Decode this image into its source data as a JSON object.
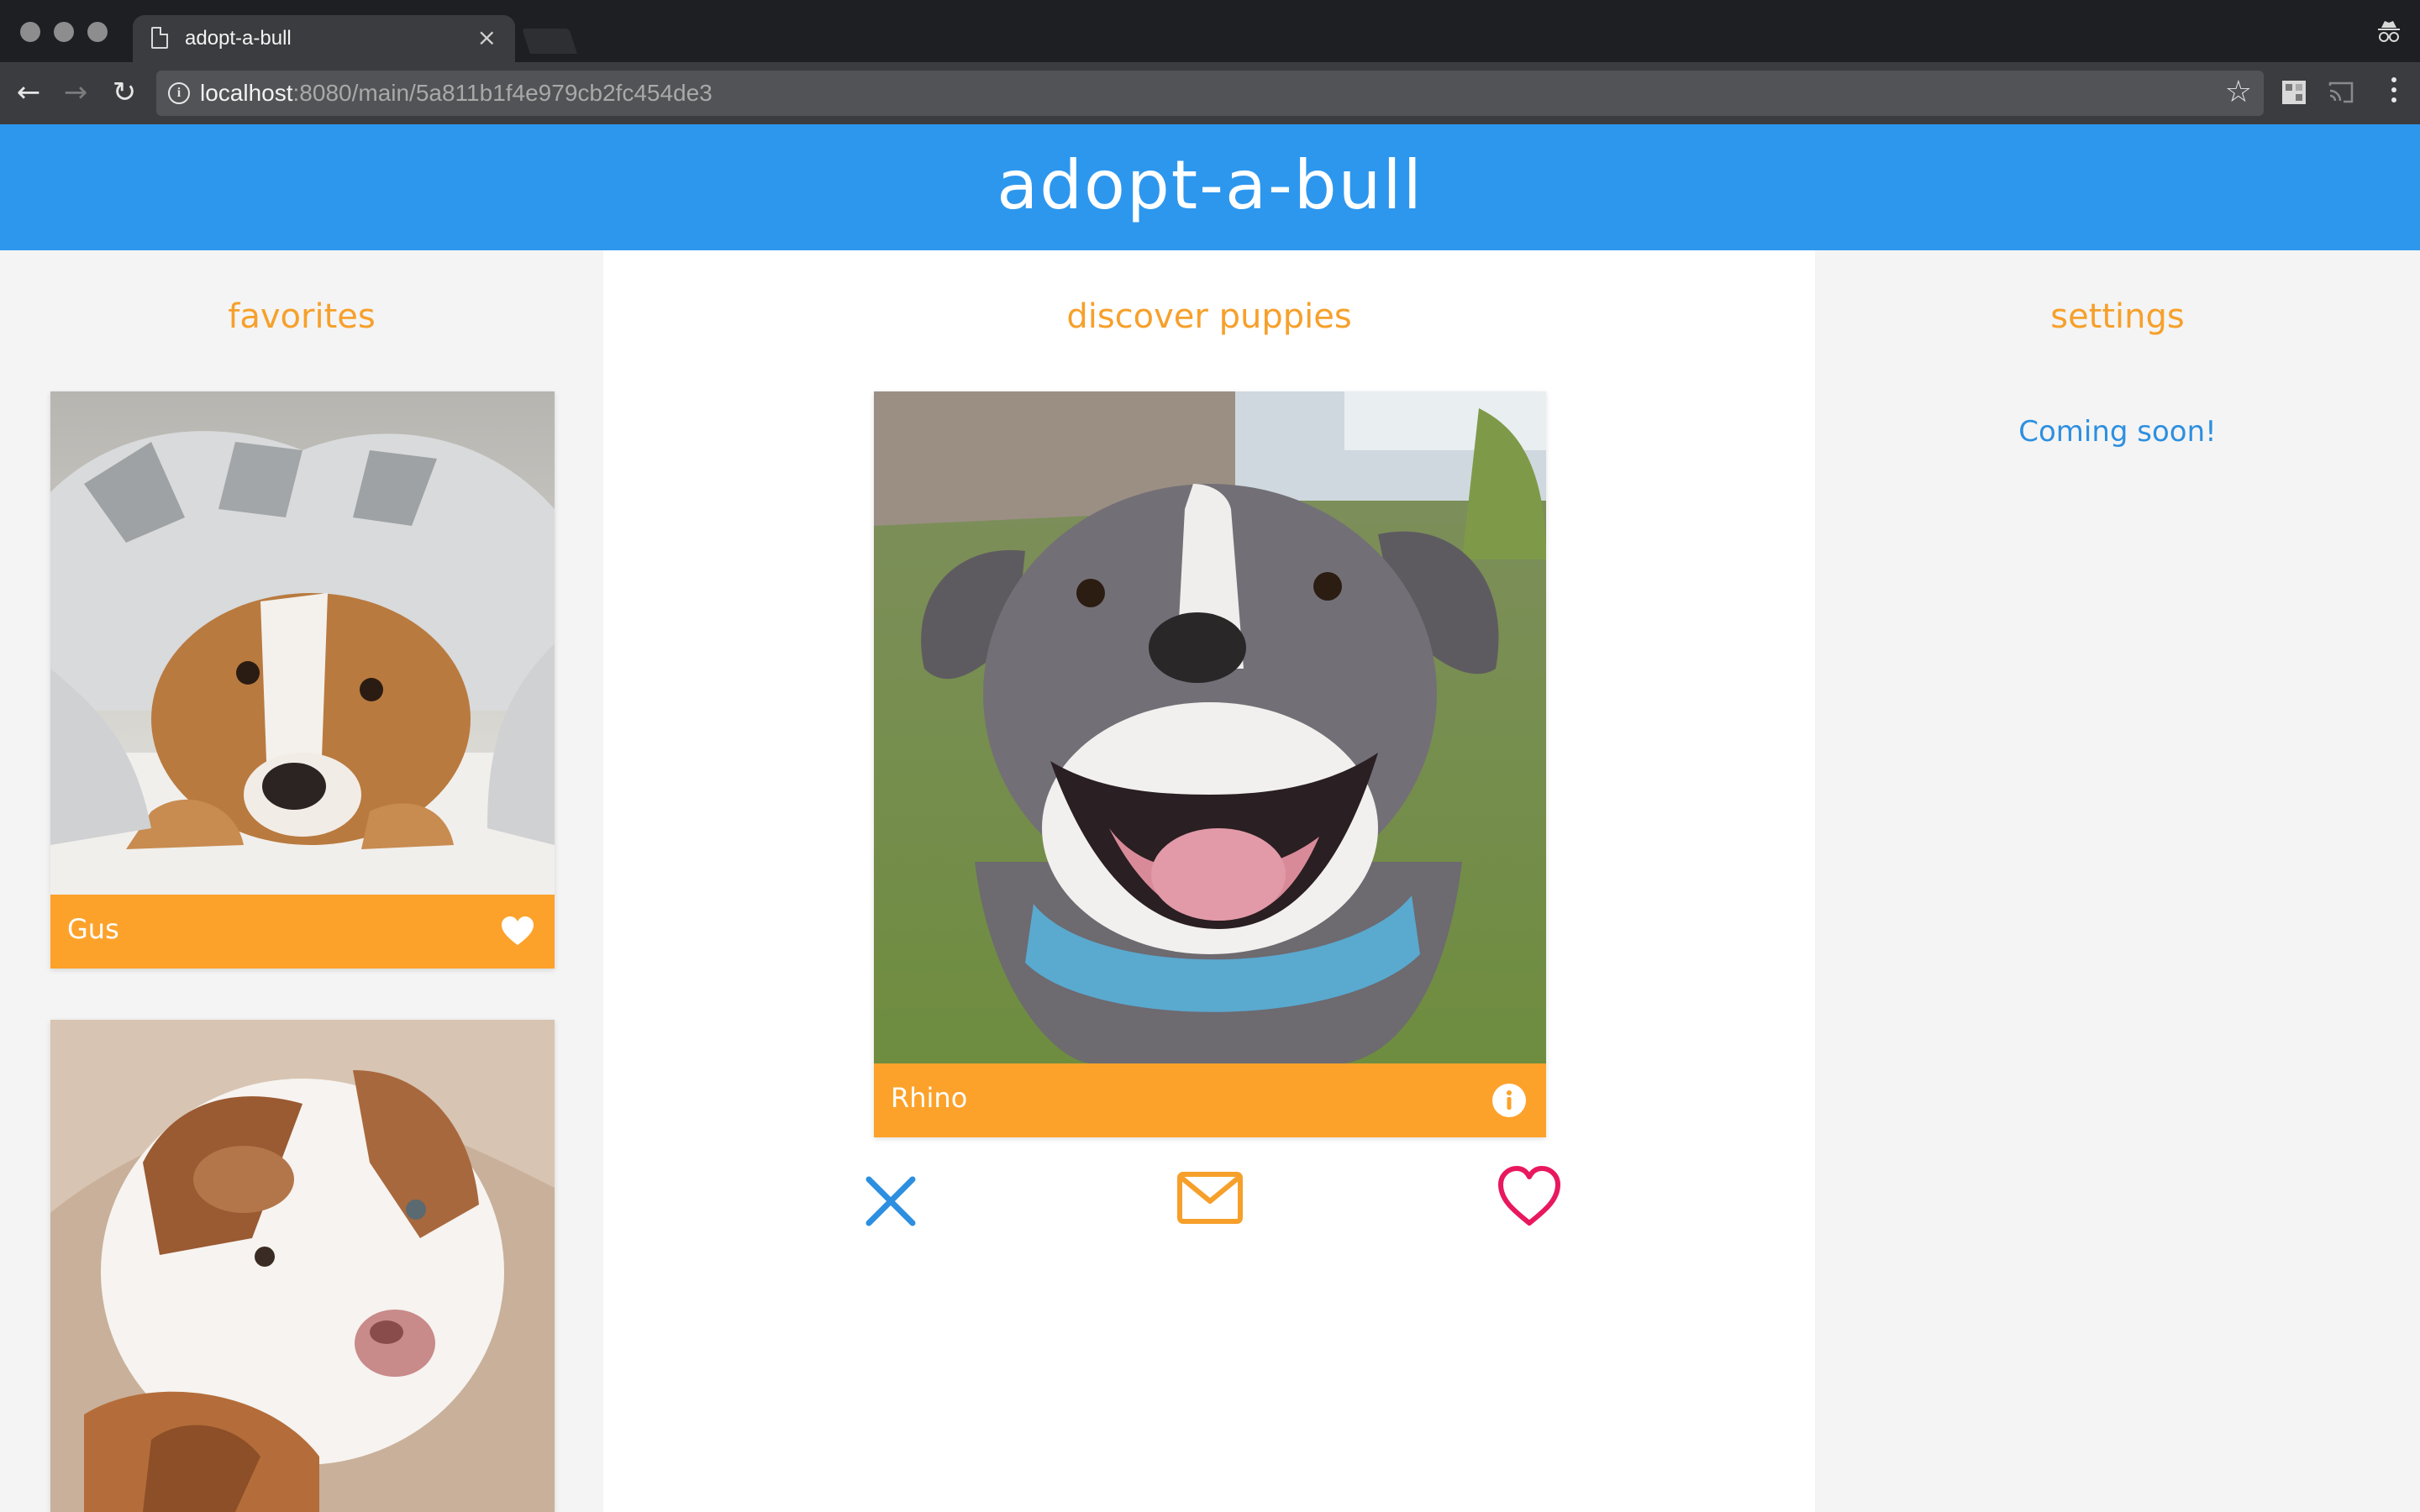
{
  "browser": {
    "tab_title": "adopt-a-bull",
    "tab_close": "×",
    "url_host": "localhost",
    "url_path": ":8080/main/5a811b1f4e979cb2fc454de3",
    "back": "←",
    "forward": "→",
    "reload": "↻",
    "star": "☆"
  },
  "app": {
    "title": "adopt-a-bull",
    "accent": "#2d97ee",
    "orange": "#fca22b",
    "pink": "#e8185f"
  },
  "favorites": {
    "heading": "favorites",
    "items": [
      {
        "name": "Gus",
        "icon": "heart-filled-icon"
      },
      {
        "name": "",
        "icon": ""
      }
    ]
  },
  "discover": {
    "heading": "discover puppies",
    "current": {
      "name": "Rhino",
      "icon": "info-icon"
    },
    "actions": [
      {
        "id": "reject",
        "icon": "x-icon"
      },
      {
        "id": "message",
        "icon": "mail-icon"
      },
      {
        "id": "favorite",
        "icon": "heart-outline-icon"
      }
    ]
  },
  "settings": {
    "heading": "settings",
    "message": "Coming soon!"
  }
}
